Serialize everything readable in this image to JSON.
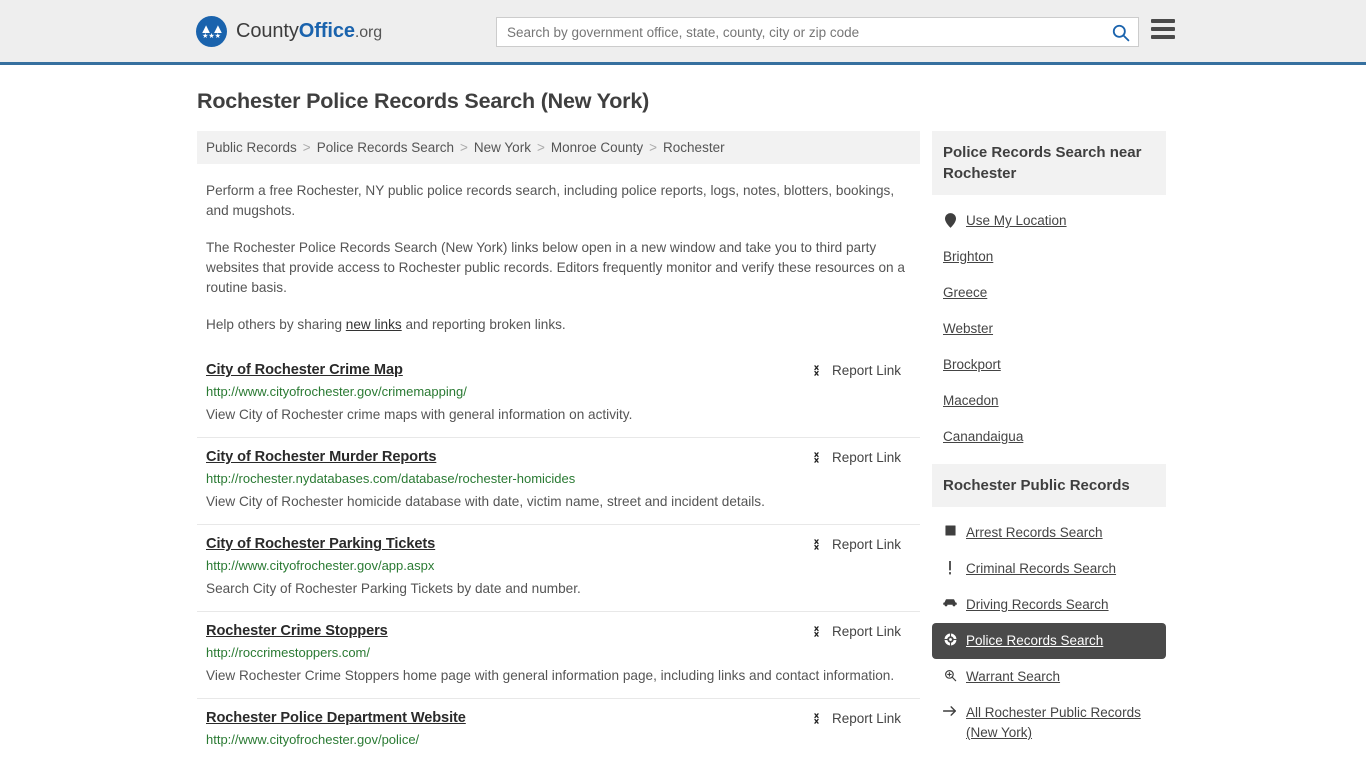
{
  "header": {
    "brand": {
      "part1": "County",
      "part2": "Office",
      "tld": ".org",
      "logo_icon": "eagle-stars-icon"
    },
    "search": {
      "placeholder": "Search by government office, state, county, city or zip code",
      "value": "",
      "search_icon": "search-icon"
    },
    "menu_icon": "hamburger-menu-icon"
  },
  "page_title": "Rochester Police Records Search (New York)",
  "breadcrumb": {
    "separator": ">",
    "items": [
      "Public Records",
      "Police Records Search",
      "New York",
      "Monroe County",
      "Rochester"
    ]
  },
  "intro": {
    "p1": "Perform a free Rochester, NY public police records search, including police reports, logs, notes, blotters, bookings, and mugshots.",
    "p2": "The Rochester Police Records Search (New York) links below open in a new window and take you to third party websites that provide access to Rochester public records. Editors frequently monitor and verify these resources on a routine basis.",
    "p3_before": "Help others by sharing ",
    "p3_link": "new links",
    "p3_after": " and reporting broken links."
  },
  "results": {
    "report_label": "Report Link",
    "report_icon": "broken-link-icon",
    "items": [
      {
        "title": "City of Rochester Crime Map",
        "url": "http://www.cityofrochester.gov/crimemapping/",
        "description": "View City of Rochester crime maps with general information on activity."
      },
      {
        "title": "City of Rochester Murder Reports",
        "url": "http://rochester.nydatabases.com/database/rochester-homicides",
        "description": "View City of Rochester homicide database with date, victim name, street and incident details."
      },
      {
        "title": "City of Rochester Parking Tickets",
        "url": "http://www.cityofrochester.gov/app.aspx",
        "description": "Search City of Rochester Parking Tickets by date and number."
      },
      {
        "title": "Rochester Crime Stoppers",
        "url": "http://roccrimestoppers.com/",
        "description": "View Rochester Crime Stoppers home page with general information page, including links and contact information."
      },
      {
        "title": "Rochester Police Department Website",
        "url": "http://www.cityofrochester.gov/police/",
        "description": ""
      }
    ]
  },
  "sidebar": {
    "nearby": {
      "heading": "Police Records Search near Rochester",
      "items": [
        {
          "label": "Use My Location",
          "icon": "map-pin-icon"
        },
        {
          "label": "Brighton",
          "icon": ""
        },
        {
          "label": "Greece",
          "icon": ""
        },
        {
          "label": "Webster",
          "icon": ""
        },
        {
          "label": "Brockport",
          "icon": ""
        },
        {
          "label": "Macedon",
          "icon": ""
        },
        {
          "label": "Canandaigua",
          "icon": ""
        }
      ]
    },
    "public_records": {
      "heading": "Rochester Public Records",
      "items": [
        {
          "label": "Arrest Records Search",
          "icon": "fingerprint-square-icon",
          "active": false
        },
        {
          "label": "Criminal Records Search",
          "icon": "exclamation-icon",
          "active": false
        },
        {
          "label": "Driving Records Search",
          "icon": "car-icon",
          "active": false
        },
        {
          "label": "Police Records Search",
          "icon": "police-badge-icon",
          "active": true
        },
        {
          "label": "Warrant Search",
          "icon": "magnifier-plus-icon",
          "active": false
        },
        {
          "label": "All Rochester Public Records (New York)",
          "icon": "arrow-right-icon",
          "active": false
        }
      ]
    }
  },
  "colors": {
    "brand_blue": "#1a63ad",
    "header_bg": "#eeeeee",
    "header_border": "#36709f",
    "url_green": "#2a7a33",
    "active_bg": "#4a4a4a",
    "panel_bg": "#f2f2f2"
  }
}
